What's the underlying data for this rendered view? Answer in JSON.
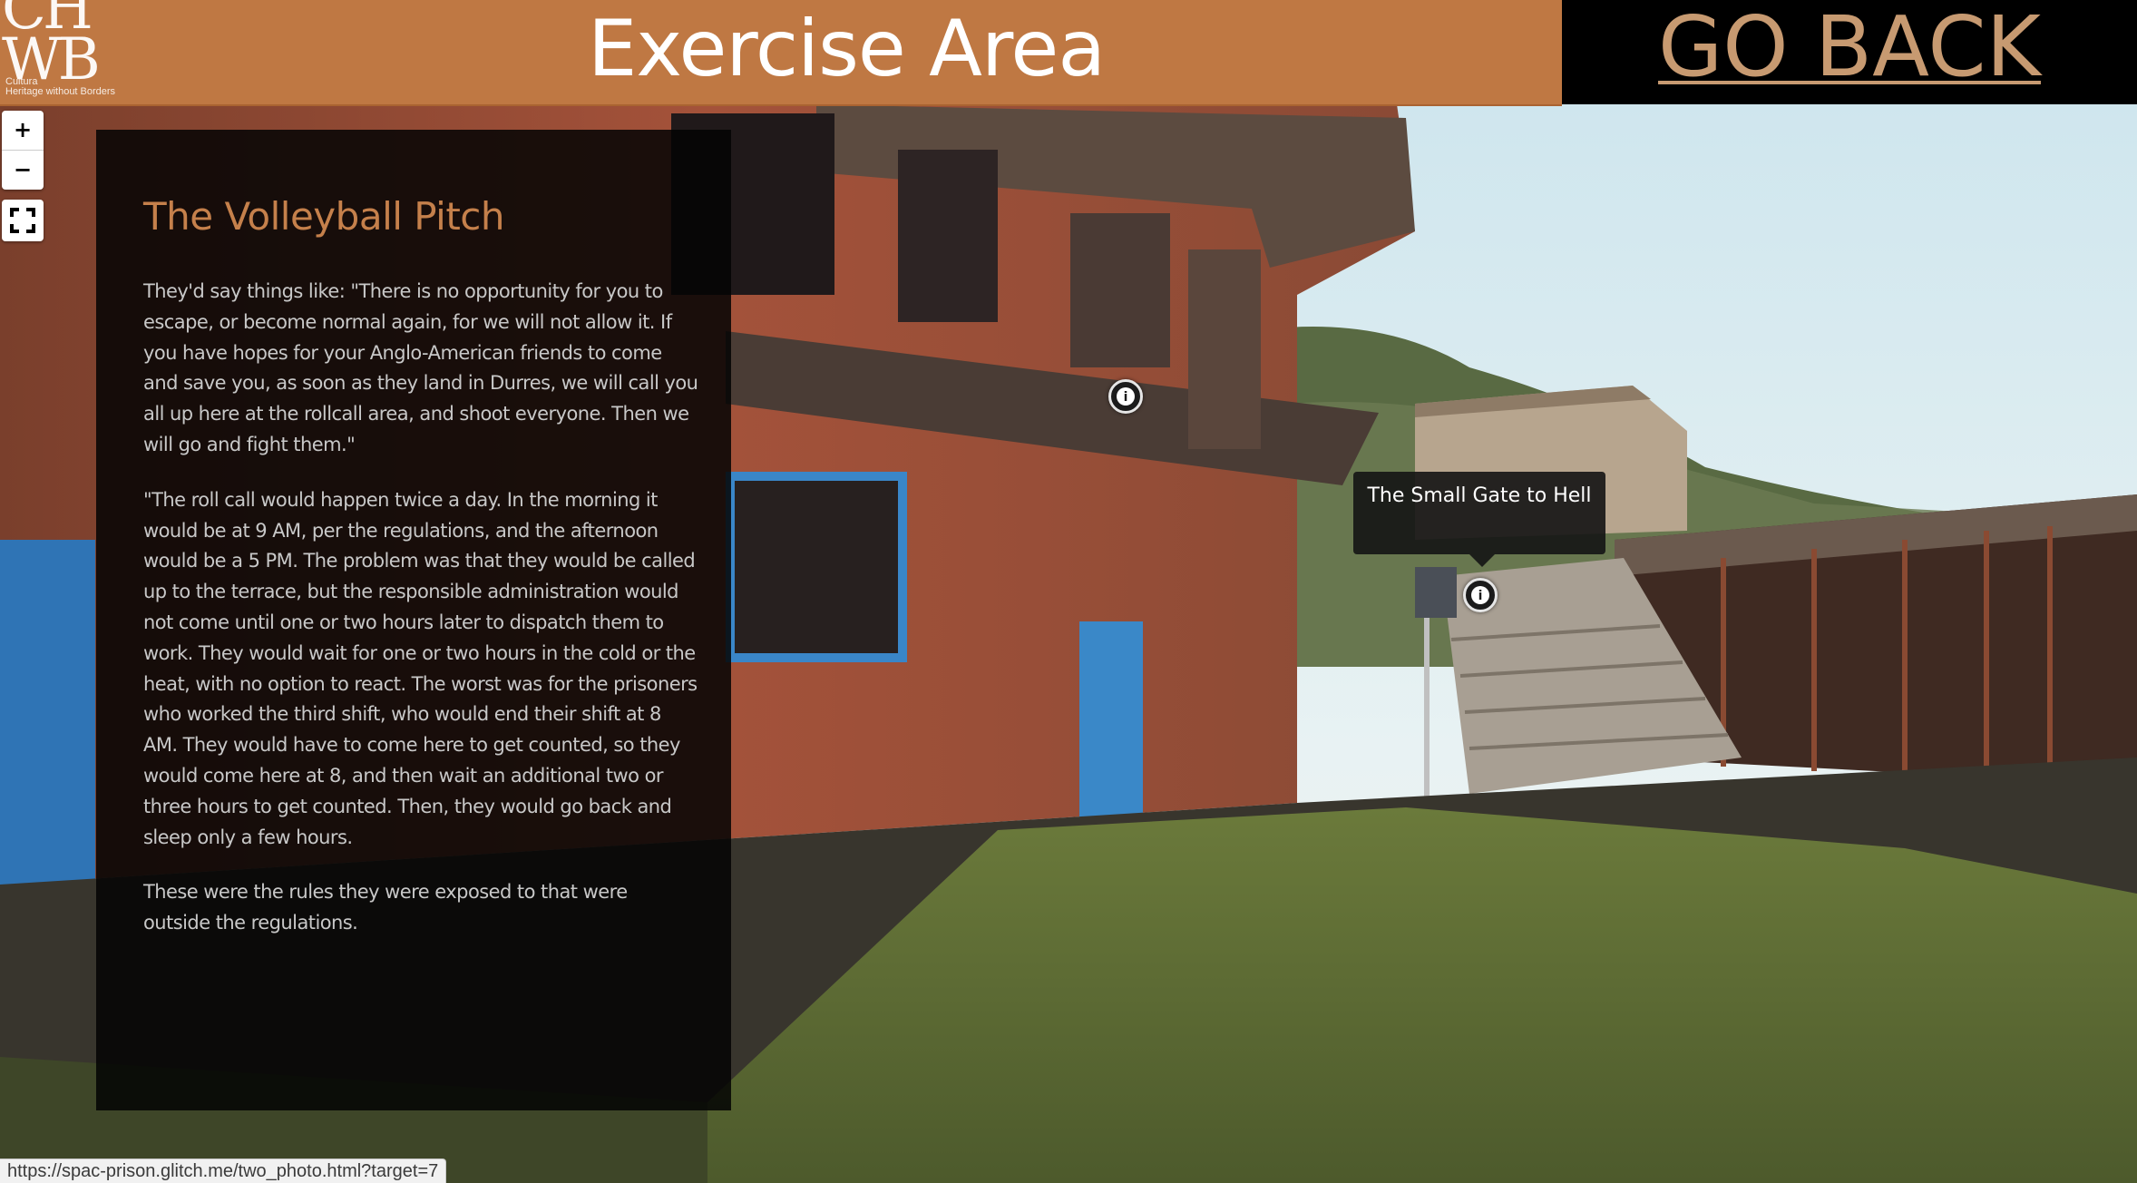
{
  "header": {
    "title": "Exercise Area",
    "go_back_label": "GO BACK"
  },
  "logo": {
    "letters_line1": "CH",
    "letters_line2": "WB",
    "tagline_line1": "Cultura",
    "tagline_line2": "Heritage without Borders"
  },
  "controls": {
    "zoom_in": "+",
    "zoom_out": "−"
  },
  "panel": {
    "heading": "The Volleyball Pitch",
    "paragraphs": [
      "They'd say things like: \"There is no opportunity for you to escape, or become normal again, for we will not allow it. If you have hopes for your Anglo-American friends to come and save you, as soon as they land in Durres, we will call you all up here at the rollcall area, and shoot everyone. Then we will go and fight them.\"",
      "\"The roll call would happen twice a day. In the morning it would be at 9 AM, per the regulations, and the afternoon would be a 5 PM. The problem was that they would be called up to the terrace, but the responsible administration would not come until one or two hours later to dispatch them to work. They would wait for one or two hours in the cold or the heat, with no option to react. The worst was for the prisoners who worked the third shift, who would end their shift at 8 AM. They would have to come here to get counted, so they would come here at 8, and then wait an additional two or three hours to get counted. Then, they would go back and sleep only a few hours.",
      "These were the rules they were exposed to that were outside the regulations."
    ]
  },
  "hotspots": {
    "tooltip_label": "The Small Gate to Hell",
    "icon_glyph": "i"
  },
  "status_bar": {
    "url": "https://spac-prison.glitch.me/two_photo.html?target=7"
  },
  "colors": {
    "header_bg": "#bf7843",
    "go_back_text": "#c79a71",
    "heading_text": "#c5804b",
    "panel_bg": "rgba(4,4,4,0.86)"
  }
}
